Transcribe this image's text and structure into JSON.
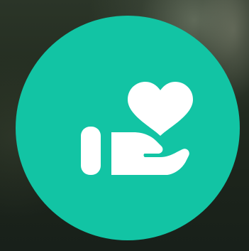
{
  "badge": {
    "color": "#12c4a4",
    "icon": "hand-holding-heart-icon",
    "icon_color": "#ffffff"
  },
  "background": {
    "color": "#222b1f"
  }
}
